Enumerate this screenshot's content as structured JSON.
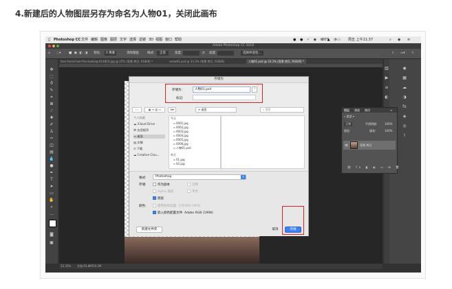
{
  "heading": "4.新建后的人物图层另存为命名为人物01，关闭此画布",
  "menubar": {
    "app": "Photoshop CC",
    "items": [
      "文件",
      "编辑",
      "图像",
      "图层",
      "文字",
      "选择",
      "滤镜",
      "3D",
      "视图",
      "窗口",
      "帮助"
    ],
    "battery": "20%",
    "clock": "周五 上午11:37"
  },
  "window_title": "Adobe Photoshop CC 2018",
  "options": {
    "feather": "羽化:",
    "feather_value": "0 像素",
    "antialias": "消除锯齿",
    "style_label": "样式:",
    "style_value": "正常",
    "width_label": "宽度:",
    "height_label": "高度:",
    "select_mask": "选择并遮住..."
  },
  "tabs": [
    "face-facial-hair-fine-looking-614810.jpg @ 25% (背景 拷贝, RGB/8) *",
    "venw01.psd @ 33.3% (背景 拷贝, RGB/8)",
    "人物01.psd @ 33.3% (背景 拷贝, RGB/8) *"
  ],
  "status": {
    "zoom": "33.33%",
    "doc": "文档:63.8M/59.2M"
  },
  "layers_panel": {
    "tab_layers": "图层",
    "tab_channels": "通道",
    "tab_paths": "路径",
    "kind": "类型",
    "blend": "正常",
    "opacity_label": "不透明度:",
    "opacity": "100%",
    "lock": "锁定:",
    "fill_label": "填充:",
    "fill": "100%",
    "layer_name": "背景 拷贝"
  },
  "dialog": {
    "title": "存储为",
    "save_as_label": "存储为:",
    "save_as_value": "人物01.psd",
    "tags_label": "标记:",
    "location": "桌面",
    "search_placeholder": "搜索",
    "sidebar_title": "个人收藏",
    "sidebar": [
      "iCloud Drive",
      "应用程序",
      "桌面",
      "文稿",
      "下载",
      "Creative Clou..."
    ],
    "files_header": "今天",
    "files": [
      "0001.jpg",
      "0002.jpg",
      "0003.jpg",
      "0004.jpg",
      "0005.jpg",
      "0006.jpg",
      "人物01.psd"
    ],
    "files_header2": "昨天",
    "files2": [
      "01.jpg",
      "02.jpg"
    ],
    "format_label": "格式:",
    "format_value": "Photoshop",
    "storage_label": "存储:",
    "opt_copy": "作为副本",
    "opt_notes": "注释",
    "opt_alpha": "Alpha 通道",
    "opt_spot": "专色",
    "opt_layers": "图层",
    "color_label": "颜色:",
    "opt_proof": "使用校样设置: 工作中的 CMYK",
    "opt_icc": "嵌入颜色配置文件: Adobe RGB (1998)",
    "new_folder": "新建文件夹",
    "cancel": "取消",
    "save": "存储"
  }
}
